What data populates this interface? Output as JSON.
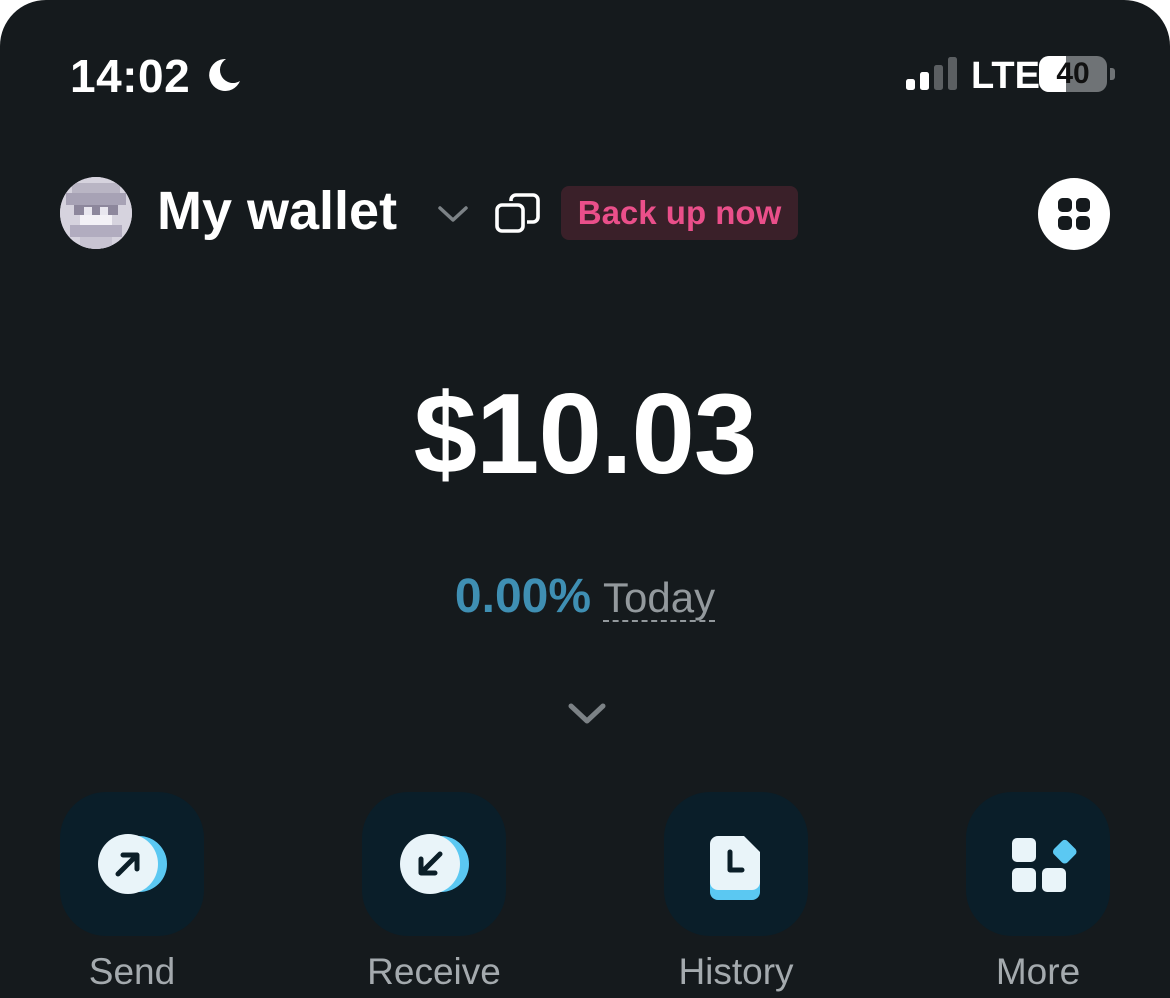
{
  "status_bar": {
    "time": "14:02",
    "focus_icon": "moon-icon",
    "signal_icon": "cellular-signal-icon",
    "network": "LTE",
    "battery_level": "40",
    "battery_fraction": 0.4
  },
  "header": {
    "avatar_icon": "pixel-avatar",
    "wallet_name": "My wallet",
    "dropdown_icon": "chevron-down-icon",
    "copy_icon": "copy-icon",
    "backup_label": "Back up now",
    "apps_icon": "grid-icon"
  },
  "balance": {
    "amount": "$10.03",
    "change_percent": "0.00%",
    "change_period": "Today",
    "expand_icon": "chevron-down-icon"
  },
  "actions": [
    {
      "label": "Send",
      "icon": "send-arrow-icon"
    },
    {
      "label": "Receive",
      "icon": "receive-arrow-icon"
    },
    {
      "label": "History",
      "icon": "history-icon"
    },
    {
      "label": "More",
      "icon": "more-apps-icon"
    }
  ],
  "colors": {
    "background": "#151a1d",
    "backup_text": "#ea4f8a",
    "backup_bg": "#3a2029",
    "change_text": "#3f8fb3",
    "action_tile": "#0a1e29",
    "accent": "#5bc8f2"
  }
}
